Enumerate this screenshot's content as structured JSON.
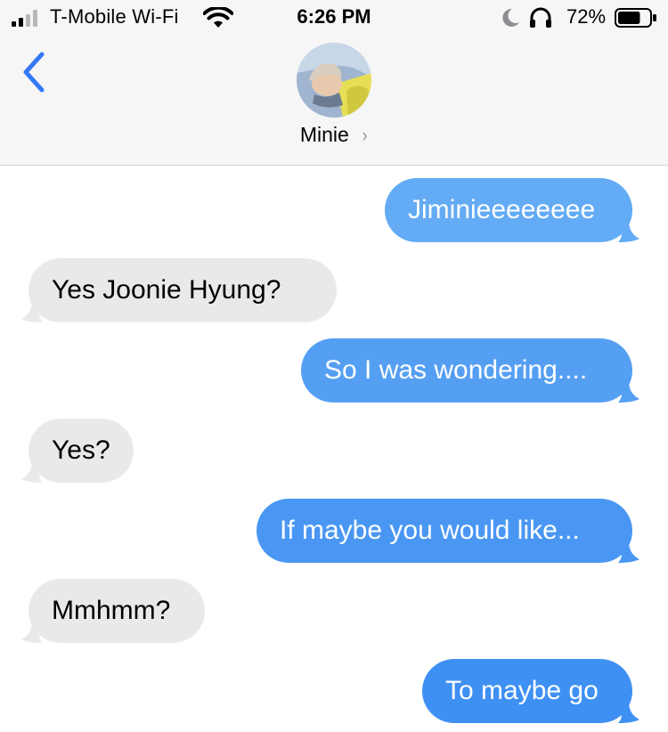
{
  "status_bar": {
    "carrier": "T-Mobile Wi-Fi",
    "time": "6:26 PM",
    "battery_percent": "72%",
    "battery_level": 0.72,
    "signal_bars": 2,
    "icons": [
      "signal-icon",
      "wifi-icon",
      "moon-icon",
      "headphones-icon",
      "battery-icon"
    ]
  },
  "header": {
    "back_icon": "chevron-left-icon",
    "contact_name": "Minie",
    "contact_chevron": "›"
  },
  "colors": {
    "outgoing_bubble": "#3f90f3",
    "incoming_bubble": "#e9e9eb",
    "accent": "#3478f6"
  },
  "messages": [
    {
      "direction": "outgoing",
      "text": "Jiminieeeeeeee"
    },
    {
      "direction": "incoming",
      "text": "Yes Joonie Hyung?"
    },
    {
      "direction": "outgoing",
      "text": "So I was wondering...."
    },
    {
      "direction": "incoming",
      "text": "Yes?"
    },
    {
      "direction": "outgoing",
      "text": "If maybe you would like..."
    },
    {
      "direction": "incoming",
      "text": "Mmhmm?"
    },
    {
      "direction": "outgoing",
      "text": "To maybe go"
    }
  ]
}
